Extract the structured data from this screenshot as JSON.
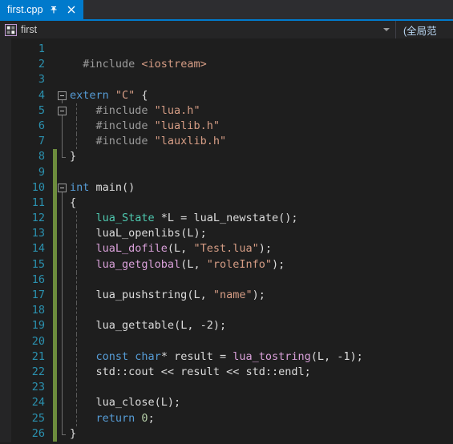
{
  "tab": {
    "label": "first.cpp",
    "pin_icon": "pin-icon",
    "close_icon": "close-icon"
  },
  "navbar": {
    "scope_icon": "namespace-icon",
    "scope_text": "first",
    "dropdown_icon": "chevron-down-icon",
    "member_text": "(全局范"
  },
  "editor": {
    "first_changed_line": 8,
    "code_lines": [
      {
        "n": 1,
        "tokens": []
      },
      {
        "n": 2,
        "tokens": [
          {
            "t": "  ",
            "c": "t-plain"
          },
          {
            "t": "#include ",
            "c": "t-pre"
          },
          {
            "t": "<iostream>",
            "c": "t-str"
          }
        ]
      },
      {
        "n": 3,
        "tokens": []
      },
      {
        "n": 4,
        "tokens": [
          {
            "t": "extern ",
            "c": "t-kw"
          },
          {
            "t": "\"C\"",
            "c": "t-str"
          },
          {
            "t": " {",
            "c": "t-punc"
          }
        ]
      },
      {
        "n": 5,
        "tokens": [
          {
            "t": "    ",
            "c": "t-plain"
          },
          {
            "t": "#include ",
            "c": "t-pre"
          },
          {
            "t": "\"lua.h\"",
            "c": "t-str"
          }
        ]
      },
      {
        "n": 6,
        "tokens": [
          {
            "t": "    ",
            "c": "t-plain"
          },
          {
            "t": "#include ",
            "c": "t-pre"
          },
          {
            "t": "\"lualib.h\"",
            "c": "t-str"
          }
        ]
      },
      {
        "n": 7,
        "tokens": [
          {
            "t": "    ",
            "c": "t-plain"
          },
          {
            "t": "#include ",
            "c": "t-pre"
          },
          {
            "t": "\"lauxlib.h\"",
            "c": "t-str"
          }
        ]
      },
      {
        "n": 8,
        "tokens": [
          {
            "t": "}",
            "c": "t-punc"
          }
        ]
      },
      {
        "n": 9,
        "tokens": []
      },
      {
        "n": 10,
        "tokens": [
          {
            "t": "int ",
            "c": "t-kw"
          },
          {
            "t": "main",
            "c": "t-plain"
          },
          {
            "t": "()",
            "c": "t-punc"
          }
        ]
      },
      {
        "n": 11,
        "tokens": [
          {
            "t": "{",
            "c": "t-punc"
          }
        ]
      },
      {
        "n": 12,
        "tokens": [
          {
            "t": "    ",
            "c": "t-plain"
          },
          {
            "t": "lua_State",
            "c": "t-type"
          },
          {
            "t": " *L = ",
            "c": "t-plain"
          },
          {
            "t": "luaL_newstate",
            "c": "t-plain"
          },
          {
            "t": "();",
            "c": "t-punc"
          }
        ]
      },
      {
        "n": 13,
        "tokens": [
          {
            "t": "    ",
            "c": "t-plain"
          },
          {
            "t": "luaL_openlibs",
            "c": "t-plain"
          },
          {
            "t": "(L);",
            "c": "t-punc"
          }
        ]
      },
      {
        "n": 14,
        "tokens": [
          {
            "t": "    ",
            "c": "t-plain"
          },
          {
            "t": "luaL_dofile",
            "c": "t-fn"
          },
          {
            "t": "(L, ",
            "c": "t-punc"
          },
          {
            "t": "\"Test.lua\"",
            "c": "t-str"
          },
          {
            "t": ");",
            "c": "t-punc"
          }
        ]
      },
      {
        "n": 15,
        "tokens": [
          {
            "t": "    ",
            "c": "t-plain"
          },
          {
            "t": "lua_getglobal",
            "c": "t-fn"
          },
          {
            "t": "(L, ",
            "c": "t-punc"
          },
          {
            "t": "\"roleInfo\"",
            "c": "t-str"
          },
          {
            "t": ");",
            "c": "t-punc"
          }
        ]
      },
      {
        "n": 16,
        "tokens": []
      },
      {
        "n": 17,
        "tokens": [
          {
            "t": "    ",
            "c": "t-plain"
          },
          {
            "t": "lua_pushstring",
            "c": "t-plain"
          },
          {
            "t": "(L, ",
            "c": "t-punc"
          },
          {
            "t": "\"name\"",
            "c": "t-str"
          },
          {
            "t": ");",
            "c": "t-punc"
          }
        ]
      },
      {
        "n": 18,
        "tokens": []
      },
      {
        "n": 19,
        "tokens": [
          {
            "t": "    ",
            "c": "t-plain"
          },
          {
            "t": "lua_gettable",
            "c": "t-plain"
          },
          {
            "t": "(L, -2);",
            "c": "t-punc"
          }
        ]
      },
      {
        "n": 20,
        "tokens": []
      },
      {
        "n": 21,
        "tokens": [
          {
            "t": "    ",
            "c": "t-plain"
          },
          {
            "t": "const ",
            "c": "t-kw"
          },
          {
            "t": "char",
            "c": "t-kw"
          },
          {
            "t": "* result = ",
            "c": "t-plain"
          },
          {
            "t": "lua_tostring",
            "c": "t-fn"
          },
          {
            "t": "(L, -1);",
            "c": "t-punc"
          }
        ]
      },
      {
        "n": 22,
        "tokens": [
          {
            "t": "    ",
            "c": "t-plain"
          },
          {
            "t": "std::cout << result << std::endl;",
            "c": "t-plain"
          }
        ]
      },
      {
        "n": 23,
        "tokens": []
      },
      {
        "n": 24,
        "tokens": [
          {
            "t": "    ",
            "c": "t-plain"
          },
          {
            "t": "lua_close",
            "c": "t-plain"
          },
          {
            "t": "(L);",
            "c": "t-punc"
          }
        ]
      },
      {
        "n": 25,
        "tokens": [
          {
            "t": "    ",
            "c": "t-plain"
          },
          {
            "t": "return ",
            "c": "t-kw"
          },
          {
            "t": "0",
            "c": "t-num"
          },
          {
            "t": ";",
            "c": "t-punc"
          }
        ]
      },
      {
        "n": 26,
        "tokens": [
          {
            "t": "}",
            "c": "t-punc"
          }
        ]
      }
    ],
    "fold_markers": [
      {
        "line": 4,
        "type": "box"
      },
      {
        "line": 5,
        "type": "box"
      },
      {
        "line": 10,
        "type": "box"
      }
    ]
  },
  "colors": {
    "accent": "#007acc",
    "editor_bg": "#1e1e1e",
    "gutter_bg": "#252526",
    "linenum": "#2b91af",
    "changed_saved": "#6d8c3d",
    "keyword": "#569cd6",
    "string": "#d69d85",
    "type": "#4ec9b0",
    "function": "#d9a0d9",
    "preproc": "#9b9b9b",
    "number": "#b5cea8"
  }
}
